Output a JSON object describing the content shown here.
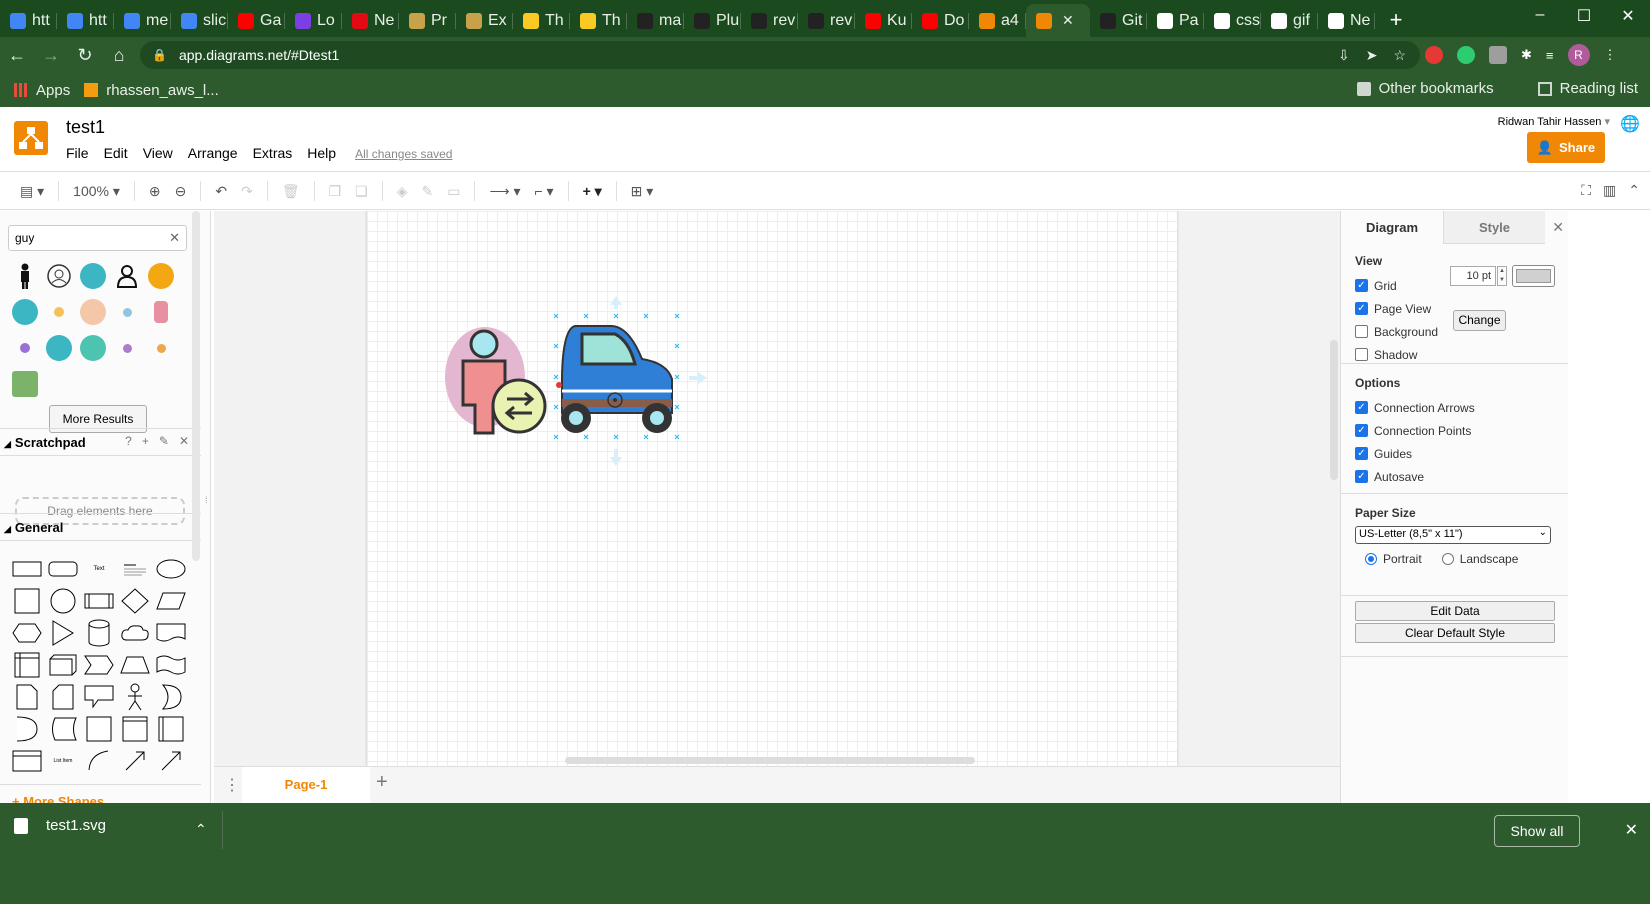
{
  "browser": {
    "tabs": [
      {
        "label": "htt",
        "color": "#4285f4"
      },
      {
        "label": "htt",
        "color": "#4285f4"
      },
      {
        "label": "me",
        "color": "#4285f4"
      },
      {
        "label": "slic",
        "color": "#4285f4"
      },
      {
        "label": "Ga",
        "color": "#ff0000"
      },
      {
        "label": "Lo",
        "color": "#7b3fe4"
      },
      {
        "label": "Ne",
        "color": "#e50914"
      },
      {
        "label": "Pr",
        "color": "#c8a24a"
      },
      {
        "label": "Ex",
        "color": "#c8a24a"
      },
      {
        "label": "Th",
        "color": "#f9ca24"
      },
      {
        "label": "Th",
        "color": "#f9ca24"
      },
      {
        "label": "ma",
        "color": "#222222"
      },
      {
        "label": "Plu",
        "color": "#222222"
      },
      {
        "label": "rev",
        "color": "#222222"
      },
      {
        "label": "rev",
        "color": "#222222"
      },
      {
        "label": "Ku",
        "color": "#ff0000"
      },
      {
        "label": "Do",
        "color": "#ff0000"
      },
      {
        "label": "a4",
        "color": "#f08705"
      }
    ],
    "active_tab": {
      "label": "",
      "color": "#f08705",
      "close": "✕"
    },
    "tabs_after": [
      {
        "label": "Git",
        "color": "#222222"
      },
      {
        "label": "Pa",
        "color": "#ffffff"
      },
      {
        "label": "css",
        "color": "#ffffff"
      },
      {
        "label": "gif",
        "color": "#ffffff"
      },
      {
        "label": "Ne",
        "color": "#ffffff"
      }
    ],
    "new_tab": "+",
    "window_controls": [
      "–",
      "☐",
      "✕"
    ],
    "url": "app.diagrams.net/#Dtest1",
    "profile_initial": "R",
    "bookmarks": {
      "apps": "Apps",
      "item": "rhassen_aws_l...",
      "other": "Other bookmarks",
      "reading": "Reading list"
    }
  },
  "app": {
    "title": "test1",
    "menu": [
      "File",
      "Edit",
      "View",
      "Arrange",
      "Extras",
      "Help"
    ],
    "save_status": "All changes saved",
    "user": "Ridwan Tahir Hassen",
    "share_label": "Share",
    "zoom": "100%",
    "brand_color": "#f08705"
  },
  "sidebar": {
    "search_value": "guy",
    "more_results": "More Results",
    "scratchpad_title": "Scratchpad",
    "scratchpad_tools": [
      "?",
      "+",
      "✎",
      "✕"
    ],
    "dropzone": "Drag elements here",
    "general_title": "General",
    "more_shapes": "More Shapes...",
    "text_shape": "Text",
    "heading_shape": "Heading",
    "list_shape": "List Item"
  },
  "pages": {
    "tab": "Page-1"
  },
  "format_panel": {
    "tabs": [
      "Diagram",
      "Style"
    ],
    "view_title": "View",
    "view_options": [
      {
        "label": "Grid",
        "checked": true
      },
      {
        "label": "Page View",
        "checked": true
      },
      {
        "label": "Background",
        "checked": false
      },
      {
        "label": "Shadow",
        "checked": false
      }
    ],
    "grid_size": "10 pt",
    "change_label": "Change",
    "options_title": "Options",
    "options": [
      {
        "label": "Connection Arrows",
        "checked": true
      },
      {
        "label": "Connection Points",
        "checked": true
      },
      {
        "label": "Guides",
        "checked": true
      },
      {
        "label": "Autosave",
        "checked": true
      }
    ],
    "paper_title": "Paper Size",
    "paper_size": "US-Letter (8,5\" x 11\")",
    "portrait": "Portrait",
    "landscape": "Landscape",
    "edit_data": "Edit Data",
    "clear_style": "Clear Default Style"
  },
  "downloads": {
    "file": "test1.svg",
    "show_all": "Show all"
  }
}
